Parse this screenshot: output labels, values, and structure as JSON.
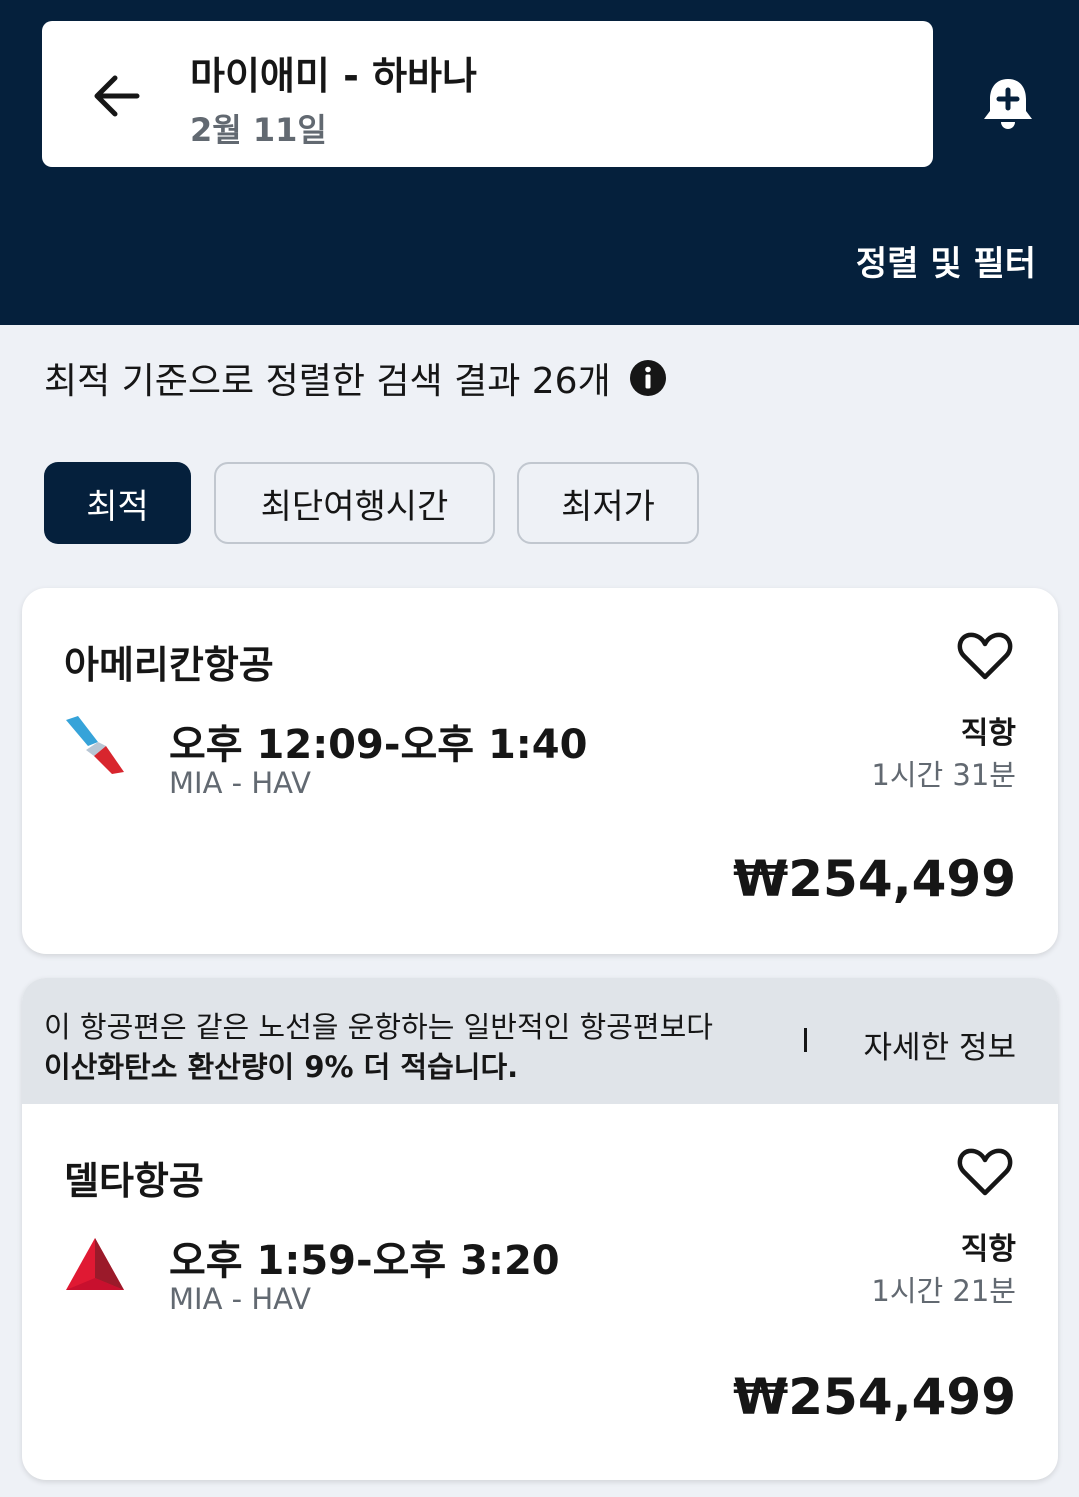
{
  "header": {
    "route": "마이애미 - 하바나",
    "date": "2월 11일",
    "back_icon": "arrow-left-icon",
    "alert_icon": "bell-plus-icon",
    "sort_filter_label": "정렬 및 필터"
  },
  "results": {
    "summary": "최적 기준으로 정렬한 검색 결과 26개",
    "info_icon": "info-icon"
  },
  "tabs": [
    {
      "label": "최적",
      "active": true
    },
    {
      "label": "최단여행시간",
      "active": false
    },
    {
      "label": "최저가",
      "active": false
    }
  ],
  "eco_banner": {
    "line1": "이 항공편은 같은 노선을 운항하는 일반적인 항공편보다",
    "line2": "이산화탄소 환산량이 9% 더 적습니다.",
    "more_label": "자세한 정보"
  },
  "flights": [
    {
      "airline": "아메리칸항공",
      "times": "오후 12:09-오후 1:40",
      "airports": "MIA - HAV",
      "stops": "직항",
      "duration": "1시간 31분",
      "price": "₩254,499",
      "logo_icon": "american-airlines-logo-icon"
    },
    {
      "airline": "델타항공",
      "times": "오후 1:59-오후 3:20",
      "airports": "MIA - HAV",
      "stops": "직항",
      "duration": "1시간 21분",
      "price": "₩254,499",
      "logo_icon": "delta-logo-icon"
    }
  ],
  "colors": {
    "header_bg": "#05203c",
    "page_bg": "#eef1f6",
    "banner_bg": "#e0e4e9",
    "aa_blue": "#36a3d9",
    "aa_red": "#d8262e",
    "delta_red": "#e01933"
  }
}
